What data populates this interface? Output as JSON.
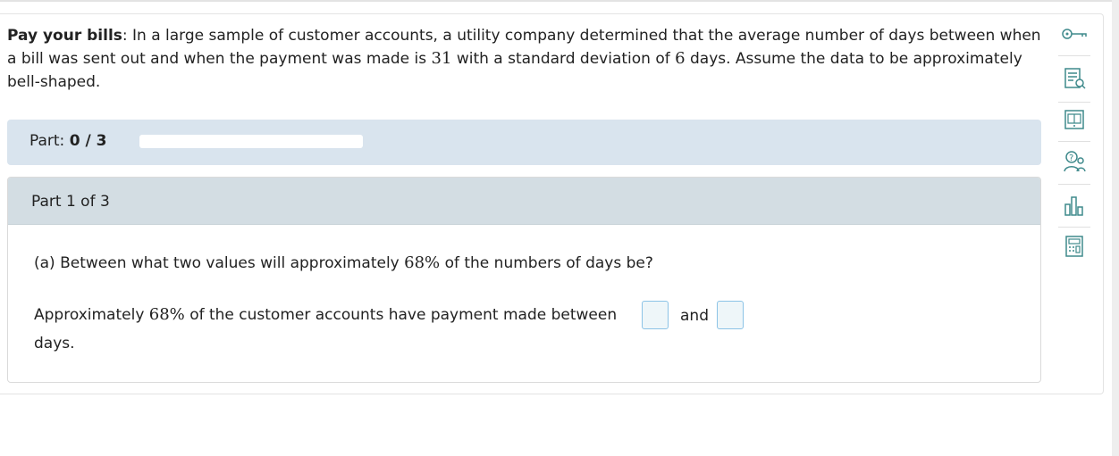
{
  "problem": {
    "title": "Pay your bills",
    "text_before_mean": ": In a large sample of customer accounts, a utility company determined that the average number of days between when a bill was sent out and when the payment was made is ",
    "mean": "31",
    "text_before_sd": " with a standard deviation of ",
    "sd": "6",
    "text_after_sd": " days. Assume the data to be approximately bell-shaped."
  },
  "progress": {
    "label": "Part:",
    "value": "0 / 3",
    "completed": 0,
    "total": 3
  },
  "part": {
    "title": "Part 1 of 3",
    "question_prefix": "(a) Between what two values will approximately ",
    "question_percent": "68%",
    "question_suffix": " of the numbers of days be?",
    "answer_prefix": "Approximately ",
    "answer_percent": "68%",
    "answer_middle": " of the customer accounts have payment made between",
    "answer_and": "and",
    "answer_days": "days."
  },
  "answers": {
    "lower": "",
    "upper": ""
  },
  "sidebar": {
    "tools": [
      "key-icon",
      "worksheet-search-icon",
      "ebook-icon",
      "question-help-icon",
      "data-table-icon",
      "calculator-icon"
    ]
  },
  "colors": {
    "progress_panel": "#d9e4ee",
    "part_header": "#d3dde3",
    "answer_box_border": "#8cc3e6",
    "icon": "#3f8a8c"
  }
}
